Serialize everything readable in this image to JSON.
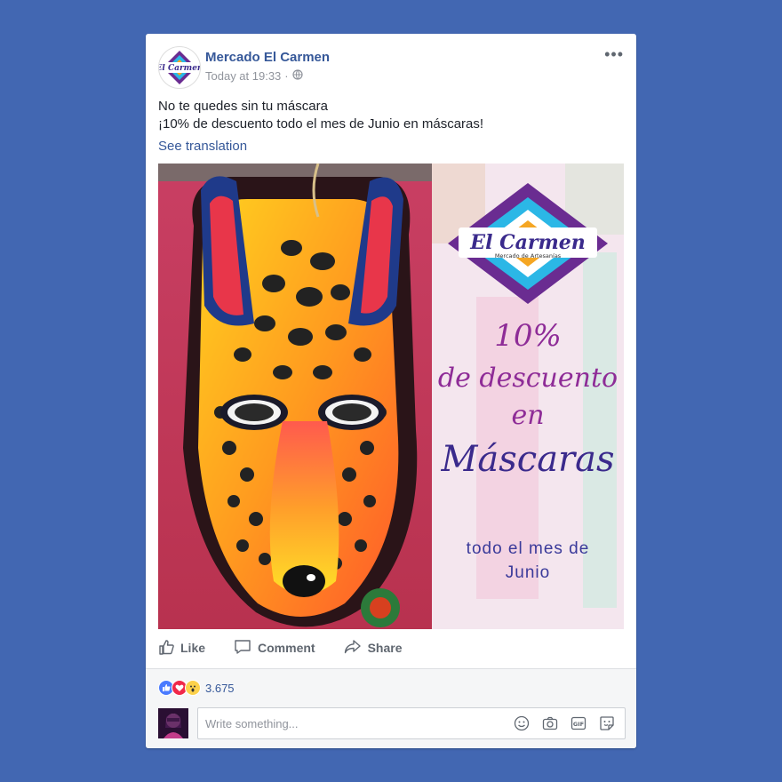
{
  "post": {
    "page_name": "Mercado El Carmen",
    "timestamp": "Today at 19:33",
    "separator": "·",
    "text_line1": "No te quedes sin tu máscara",
    "text_line2": "¡10% de descuento todo el mes de Junio en máscaras!",
    "see_translation": "See translation",
    "logo_text": "El Carmen",
    "logo_subtext": "Mercado de Artesanías"
  },
  "promo": {
    "percent": "10%",
    "line2": "de descuento",
    "line3": "en",
    "line4": "Máscaras",
    "line5a": "todo el mes de",
    "line5b": "Junio"
  },
  "actions": {
    "like": "Like",
    "comment": "Comment",
    "share": "Share"
  },
  "reactions": {
    "count": "3.675"
  },
  "comment": {
    "placeholder": "Write something..."
  },
  "colors": {
    "facebook_blue": "#4267b2",
    "link_blue": "#365899",
    "promo_purple": "#8e2c97"
  }
}
